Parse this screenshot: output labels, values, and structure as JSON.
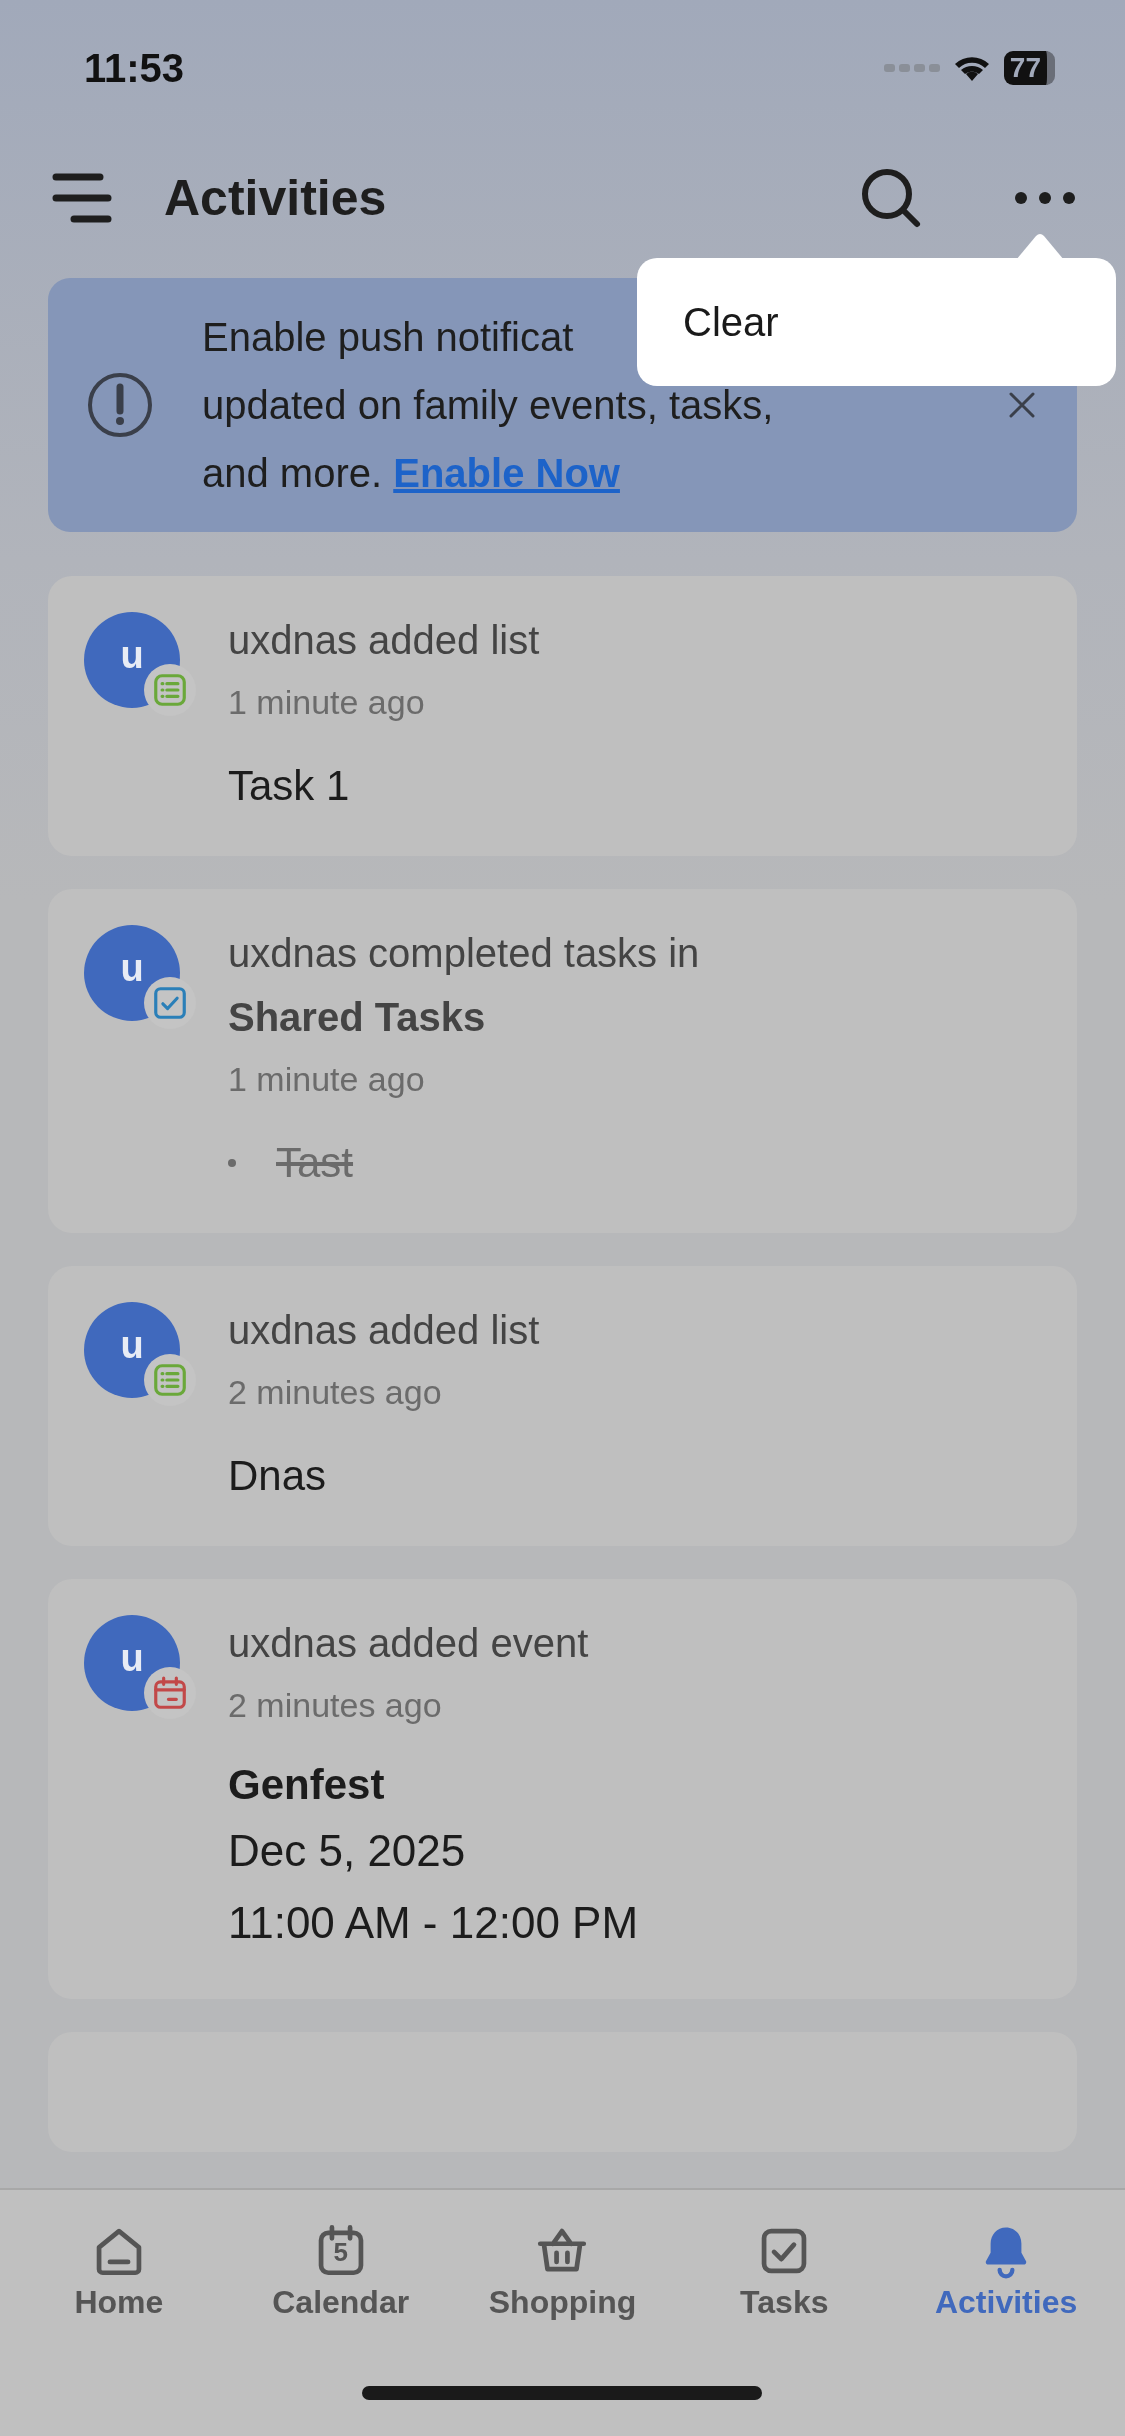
{
  "status_bar": {
    "time": "11:53",
    "battery": "77"
  },
  "header": {
    "title": "Activities"
  },
  "menu": {
    "items": [
      {
        "label": "Clear"
      }
    ]
  },
  "banner": {
    "lines": [
      "Enable push notificat",
      "updated on family events, tasks,",
      "and more."
    ],
    "link": "Enable Now"
  },
  "activities": [
    {
      "kind": "list",
      "avatar": "u",
      "headline": "uxdnas added list",
      "time": "1 minute ago",
      "items": [
        {
          "text": "Task 1",
          "completed": false
        }
      ]
    },
    {
      "kind": "tasks",
      "avatar": "u",
      "headline": "uxdnas completed tasks in",
      "target": "Shared Tasks",
      "time": "1 minute ago",
      "items": [
        {
          "text": "Tast",
          "completed": true
        }
      ]
    },
    {
      "kind": "list",
      "avatar": "u",
      "headline": "uxdnas added list",
      "time": "2 minutes ago",
      "items": [
        {
          "text": "Dnas",
          "completed": false
        }
      ]
    },
    {
      "kind": "event",
      "avatar": "u",
      "headline": "uxdnas added event",
      "time": "2 minutes ago",
      "event": {
        "title": "Genfest",
        "date": "Dec 5, 2025",
        "hours": "11:00 AM - 12:00 PM"
      }
    }
  ],
  "tab_bar": [
    {
      "kind": "home",
      "label": "Home",
      "selected": false
    },
    {
      "kind": "calendar",
      "label": "Calendar",
      "day": "5",
      "selected": false
    },
    {
      "kind": "shopping",
      "label": "Shopping",
      "selected": false
    },
    {
      "kind": "tasks",
      "label": "Tasks",
      "selected": false
    },
    {
      "kind": "activities",
      "label": "Activities",
      "selected": true
    }
  ]
}
